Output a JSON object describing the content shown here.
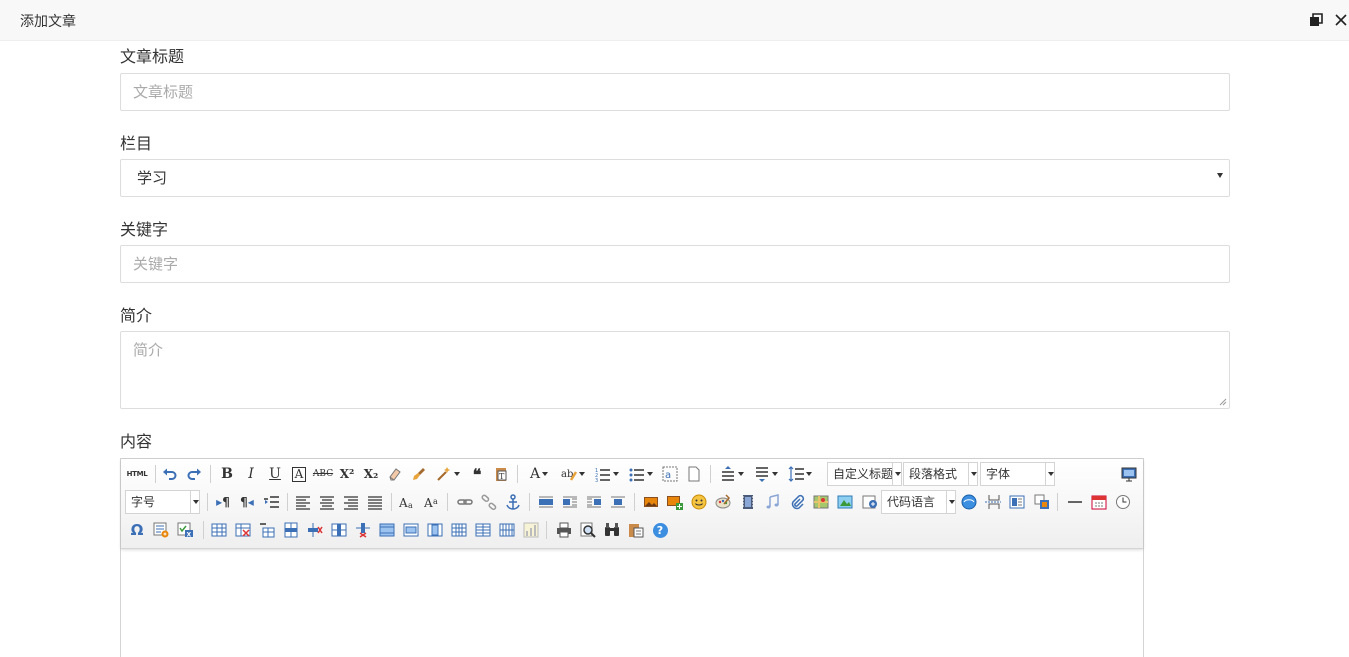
{
  "window": {
    "title": "添加文章"
  },
  "form": {
    "title_label": "文章标题",
    "title_placeholder": "文章标题",
    "category_label": "栏目",
    "category_value": "学习",
    "keywords_label": "关键字",
    "keywords_placeholder": "关键字",
    "summary_label": "简介",
    "summary_placeholder": "简介",
    "content_label": "内容"
  },
  "editor": {
    "custom_heading": "自定义标题",
    "paragraph_format": "段落格式",
    "font_family": "字体",
    "font_size": "字号",
    "code_language": "代码语言",
    "html_button": "HTML",
    "bold": "B",
    "italic": "I",
    "underline": "U",
    "fontcolor": "A",
    "strikethrough": "ABC",
    "superscript": "X²",
    "subscript": "X₂",
    "quote": "❝",
    "special_char": "Ω",
    "rtl": "¶",
    "help": "?",
    "accent_colors": {
      "blue": "#3b6fb6",
      "orange": "#e8860c",
      "green": "#3a9a3a"
    }
  }
}
